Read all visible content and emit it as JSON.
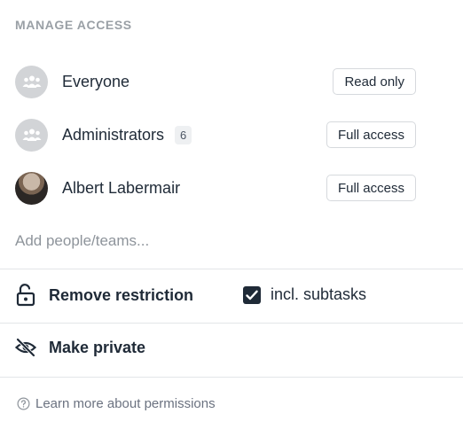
{
  "header": {
    "title": "MANAGE ACCESS"
  },
  "members": [
    {
      "name": "Everyone",
      "access": "Read only",
      "icon": "group-icon"
    },
    {
      "name": "Administrators",
      "count": "6",
      "access": "Full access",
      "icon": "group-icon"
    },
    {
      "name": "Albert Labermair",
      "access": "Full access",
      "icon": "user-photo"
    }
  ],
  "add_people": {
    "placeholder": "Add people/teams..."
  },
  "actions": {
    "remove_restriction": {
      "label": "Remove restriction",
      "icon": "unlock-icon"
    },
    "include_subtasks": {
      "label": "incl. subtasks",
      "checked": true
    },
    "make_private": {
      "label": "Make private",
      "icon": "eye-off-icon"
    }
  },
  "footer": {
    "learn_more": "Learn more about permissions",
    "icon": "help-circle-icon"
  },
  "colors": {
    "primary_text": "#1f2a37",
    "muted_text": "#9aa0a6",
    "checkbox": "#1f2a37"
  }
}
